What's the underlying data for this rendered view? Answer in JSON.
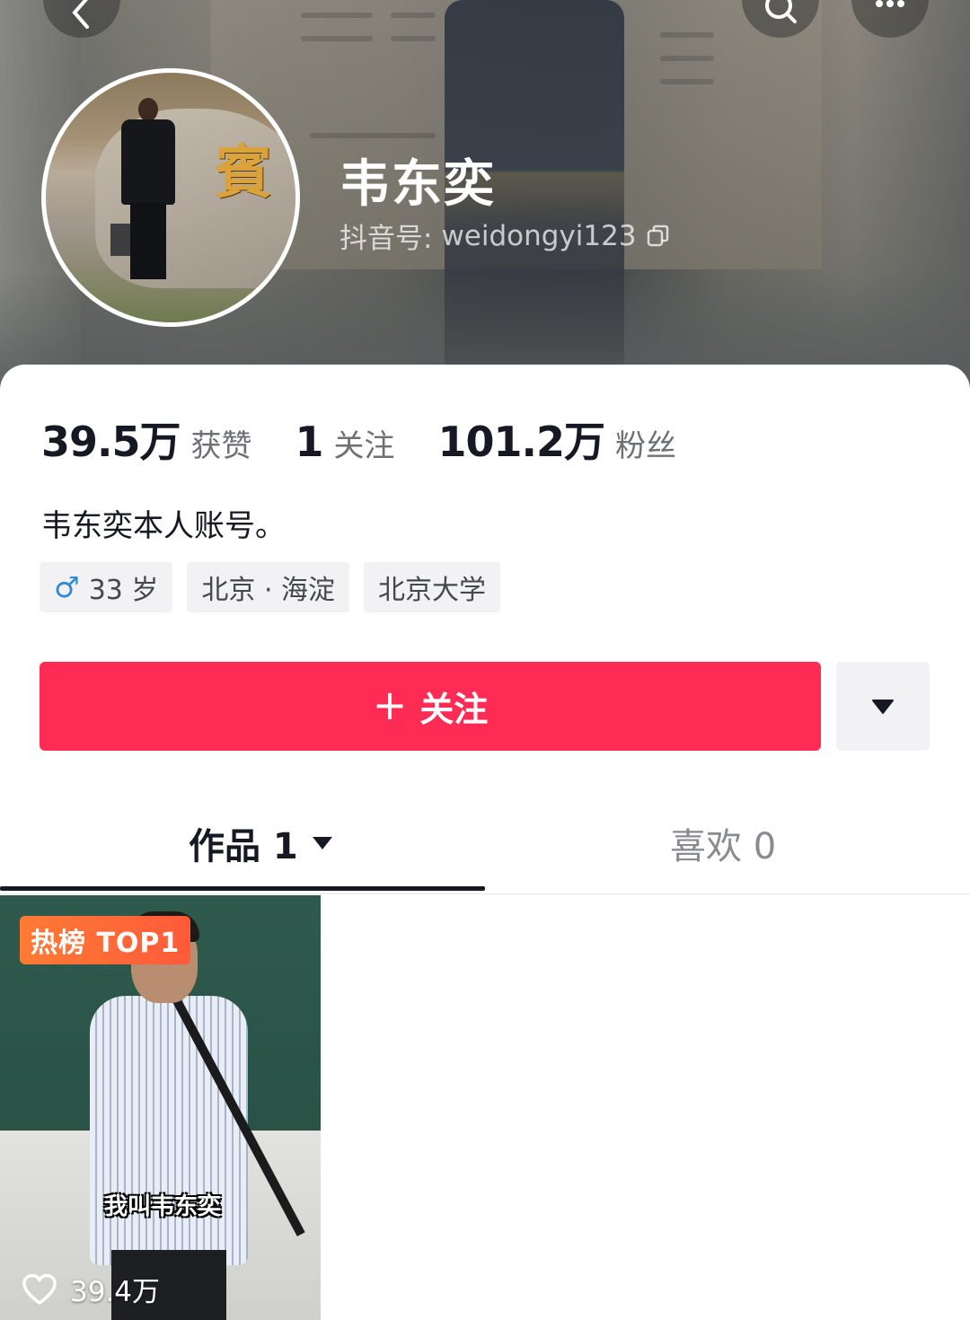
{
  "header": {
    "name": "韦东奕",
    "douyin_id_label": "抖音号:",
    "douyin_id": "weidongyi123",
    "avatar_glyph": "賓"
  },
  "stats": [
    {
      "value": "39.5万",
      "label": "获赞"
    },
    {
      "value": "1",
      "label": "关注"
    },
    {
      "value": "101.2万",
      "label": "粉丝"
    }
  ],
  "bio": "韦东奕本人账号。",
  "tags": {
    "gender_symbol": "♂",
    "age": "33 岁",
    "location": "北京 · 海淀",
    "school": "北京大学"
  },
  "actions": {
    "follow_plus": "+",
    "follow_label": "关注"
  },
  "tabs": {
    "works_label": "作品 1",
    "likes_label": "喜欢 0"
  },
  "video": {
    "badge": "热榜 TOP1",
    "caption": "我叫韦东奕",
    "likes": "39.4万"
  },
  "colors": {
    "accent": "#fe2c55",
    "badge": "#ff6a36",
    "gender": "#2f8bd8"
  },
  "icons": [
    "back-icon",
    "search-icon",
    "more-icon",
    "copy-icon",
    "caret-down-icon",
    "heart-icon"
  ]
}
